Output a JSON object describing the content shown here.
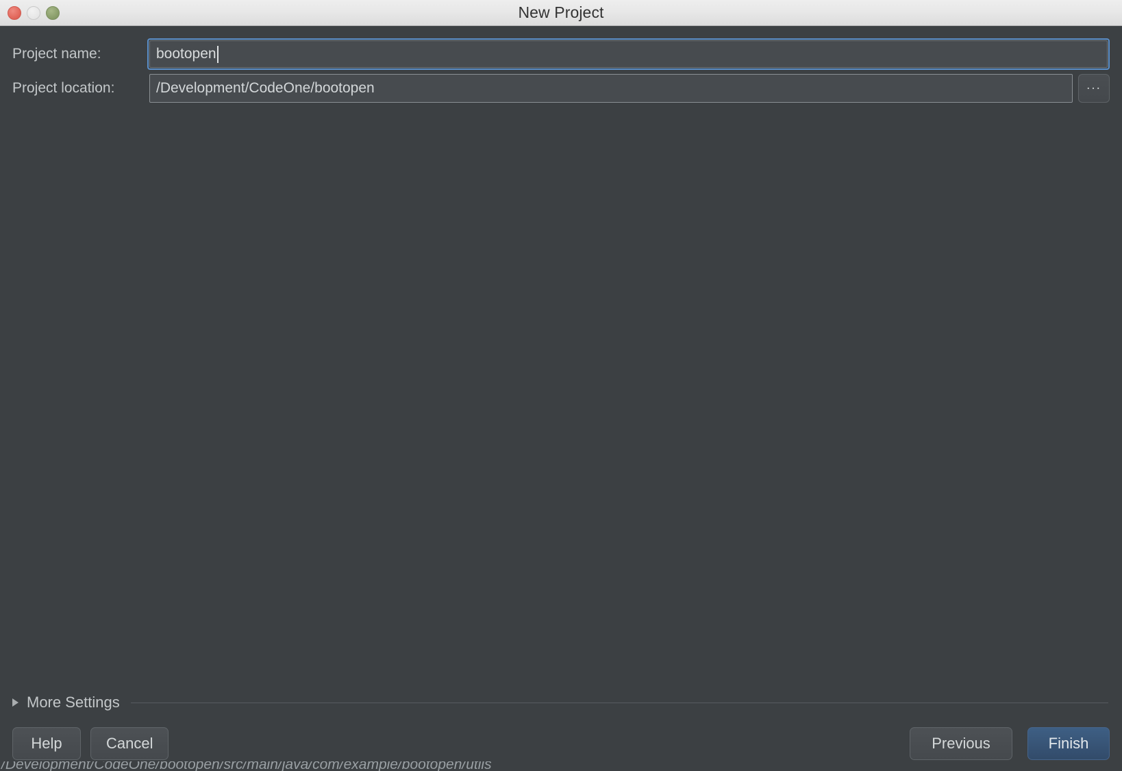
{
  "window": {
    "title": "New Project",
    "traffic_lights": [
      {
        "name": "close",
        "color": "#e2685c"
      },
      {
        "name": "minimize",
        "color": "#e6e6e6"
      },
      {
        "name": "maximize",
        "color": "#8a9e6b"
      }
    ]
  },
  "form": {
    "project_name": {
      "label": "Project name:",
      "value": "bootopen",
      "placeholder": "",
      "focused": true
    },
    "project_location": {
      "label": "Project location:",
      "value": "/Development/CodeOne/bootopen",
      "placeholder": "",
      "browse_label": "..."
    }
  },
  "more_settings": {
    "label": "More Settings",
    "expanded": false
  },
  "buttons": {
    "help": "Help",
    "cancel": "Cancel",
    "previous": "Previous",
    "finish": "Finish"
  },
  "status": {
    "bottom_text": "/Development/CodeOne/bootopen/src/main/java/com/example/bootopen/utils"
  },
  "colors": {
    "background": "#3c4043",
    "titlebar": "#e7e7e7",
    "accent": "#5b8fc9",
    "default_button": "#35506f",
    "text": "#c3c7c9"
  }
}
